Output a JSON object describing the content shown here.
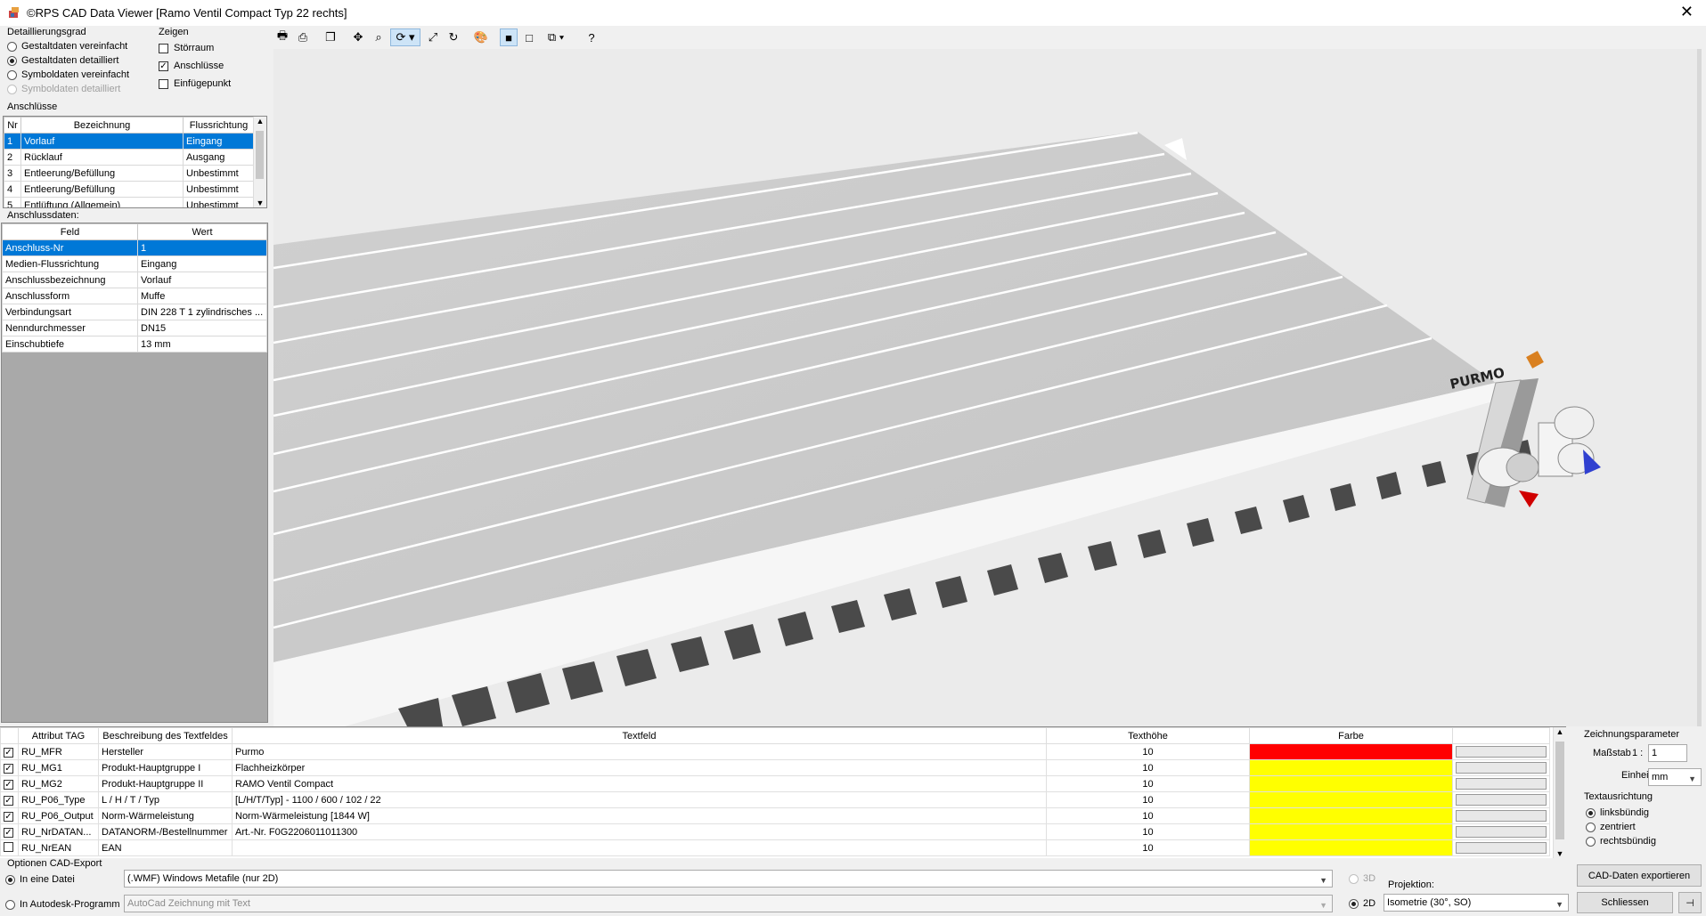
{
  "window": {
    "title": "©RPS CAD Data Viewer [Ramo Ventil Compact Typ 22 rechts]"
  },
  "detail": {
    "label": "Detaillierungsgrad",
    "options": [
      {
        "label": "Gestaltdaten vereinfacht",
        "selected": false,
        "disabled": false
      },
      {
        "label": "Gestaltdaten detailliert",
        "selected": true,
        "disabled": false
      },
      {
        "label": "Symboldaten vereinfacht",
        "selected": false,
        "disabled": false
      },
      {
        "label": "Symboldaten detailliert",
        "selected": false,
        "disabled": true
      }
    ]
  },
  "show": {
    "label": "Zeigen",
    "options": [
      {
        "label": "Störraum",
        "checked": false
      },
      {
        "label": "Anschlüsse",
        "checked": true
      },
      {
        "label": "Einfügepunkt",
        "checked": false
      }
    ]
  },
  "connections": {
    "label": "Anschlüsse",
    "headers": [
      "Nr",
      "Bezeichnung",
      "Flussrichtung"
    ],
    "rows": [
      [
        "1",
        "Vorlauf",
        "Eingang"
      ],
      [
        "2",
        "Rücklauf",
        "Ausgang"
      ],
      [
        "3",
        "Entleerung/Befüllung",
        "Unbestimmt"
      ],
      [
        "4",
        "Entleerung/Befüllung",
        "Unbestimmt"
      ],
      [
        "5",
        "Entlüftung (Allgemein)",
        "Unbestimmt"
      ]
    ]
  },
  "connection_data": {
    "label": "Anschlussdaten:",
    "headers": [
      "Feld",
      "Wert"
    ],
    "rows": [
      [
        "Anschluss-Nr",
        "1"
      ],
      [
        "Medien-Flussrichtung",
        "Eingang"
      ],
      [
        "Anschlussbezeichnung",
        "Vorlauf"
      ],
      [
        "Anschlussform",
        "Muffe"
      ],
      [
        "Verbindungsart",
        "DIN 228 T 1 zylindrisches ..."
      ],
      [
        "Nenndurchmesser",
        "DN15"
      ],
      [
        "Einschubtiefe",
        "13 mm"
      ]
    ]
  },
  "model": {
    "brand": "PURMO"
  },
  "attributes": {
    "headers": [
      "Attribut TAG",
      "Beschreibung des Textfeldes",
      "Textfeld",
      "Texthöhe",
      "Farbe"
    ],
    "rows": [
      {
        "checked": true,
        "tag": "RU_MFR",
        "desc": "Hersteller",
        "text": "Purmo",
        "height": "10",
        "color": "#ff0000"
      },
      {
        "checked": true,
        "tag": "RU_MG1",
        "desc": "Produkt-Hauptgruppe I",
        "text": "Flachheizkörper",
        "height": "10",
        "color": "#ffff00"
      },
      {
        "checked": true,
        "tag": "RU_MG2",
        "desc": "Produkt-Hauptgruppe II",
        "text": "RAMO Ventil Compact",
        "height": "10",
        "color": "#ffff00"
      },
      {
        "checked": true,
        "tag": "RU_P06_Type",
        "desc": "L / H / T / Typ",
        "text": "[L/H/T/Typ] - 1100 / 600 / 102 / 22",
        "height": "10",
        "color": "#ffff00"
      },
      {
        "checked": true,
        "tag": "RU_P06_Output",
        "desc": "Norm-Wärmeleistung",
        "text": "Norm-Wärmeleistung [1844 W]",
        "height": "10",
        "color": "#ffff00"
      },
      {
        "checked": true,
        "tag": "RU_NrDATAN...",
        "desc": "DATANORM-/Bestellnummer",
        "text": "Art.-Nr. F0G2206011011300",
        "height": "10",
        "color": "#ffff00"
      },
      {
        "checked": false,
        "tag": "RU_NrEAN",
        "desc": "EAN",
        "text": "",
        "height": "10",
        "color": "#ffff00"
      }
    ]
  },
  "drawing_params": {
    "label": "Zeichnungsparameter",
    "scale_label": "Maßstab",
    "scale_prefix": "1 :",
    "scale_value": "1",
    "unit_label": "Einheit",
    "unit_value": "mm",
    "text_align_label": "Textausrichtung",
    "text_align_options": [
      {
        "label": "linksbündig",
        "selected": true
      },
      {
        "label": "zentriert",
        "selected": false
      },
      {
        "label": "rechtsbündig",
        "selected": false
      }
    ]
  },
  "export": {
    "label": "Optionen CAD-Export",
    "file_label": "In eine Datei",
    "file_selected": true,
    "file_format": "(.WMF) Windows Metafile (nur 2D)",
    "program_label": "In Autodesk-Programm",
    "program_selected": false,
    "program_value": "AutoCad Zeichnung mit Text",
    "mode_3d": "3D",
    "mode_2d": "2D",
    "projection_label": "Projektion:",
    "projection_value": "Isometrie (30°, SO)",
    "export_button": "CAD-Daten exportieren",
    "close_button": "Schliessen"
  }
}
